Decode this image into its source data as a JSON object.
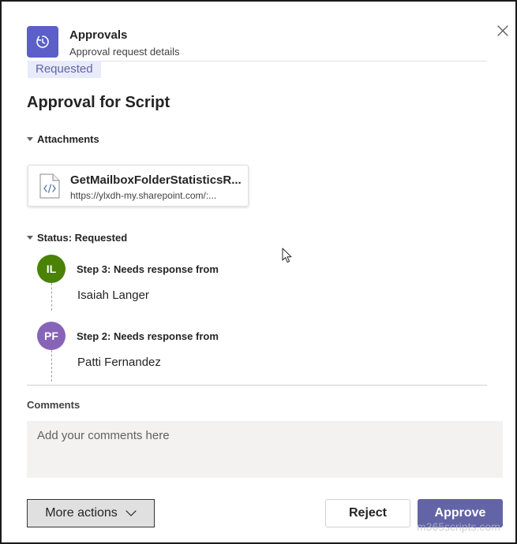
{
  "header": {
    "app_title": "Approvals",
    "app_subtitle": "Approval request details",
    "app_icon": "approvals-refresh-icon",
    "close_icon": "close-icon"
  },
  "status_chip": "Requested",
  "request_title": "Approval for Script",
  "attachments": {
    "heading": "Attachments",
    "items": [
      {
        "name": "GetMailboxFolderStatisticsR...",
        "url": "https://ylxdh-my.sharepoint.com/:...",
        "icon": "code-file-icon"
      }
    ]
  },
  "status": {
    "heading": "Status: Requested",
    "steps": [
      {
        "initials": "IL",
        "label": "Step 3: Needs response from",
        "person": "Isaiah Langer",
        "color": "#498205"
      },
      {
        "initials": "PF",
        "label": "Step 2: Needs response from",
        "person": "Patti Fernandez",
        "color": "#8764b8"
      }
    ]
  },
  "comments": {
    "label": "Comments",
    "placeholder": "Add your comments here",
    "value": ""
  },
  "actions": {
    "more_label": "More actions",
    "reject_label": "Reject",
    "approve_label": "Approve"
  },
  "watermark": "m365scripts.com",
  "colors": {
    "accent": "#6264a7",
    "app_icon_bg": "#5b5fc7",
    "chip_bg": "#e8ebfa",
    "comments_bg": "#f3f2f1"
  }
}
